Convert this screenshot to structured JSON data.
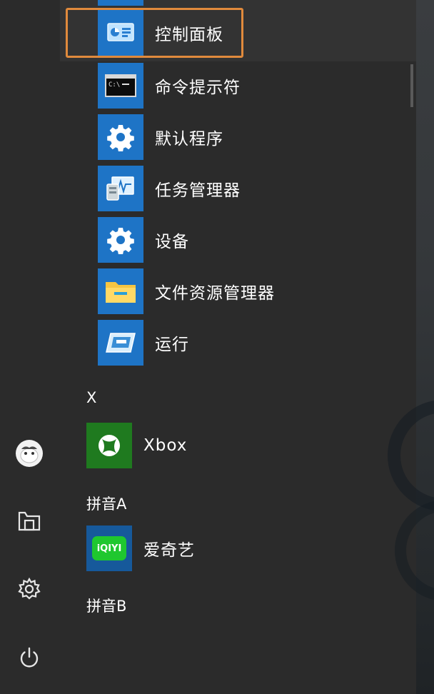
{
  "apps": [
    {
      "label": "控制面板",
      "icon": "control-panel-icon"
    },
    {
      "label": "命令提示符",
      "icon": "command-prompt-icon"
    },
    {
      "label": "默认程序",
      "icon": "gear-icon"
    },
    {
      "label": "任务管理器",
      "icon": "task-manager-icon"
    },
    {
      "label": "设备",
      "icon": "gear-icon"
    },
    {
      "label": "文件资源管理器",
      "icon": "folder-icon"
    },
    {
      "label": "运行",
      "icon": "run-icon"
    }
  ],
  "sections": {
    "x_header": "X",
    "xbox_label": "Xbox",
    "pinyin_a_header": "拼音A",
    "iqiyi_label": "爱奇艺",
    "iqiyi_logo_text": "iQIYI",
    "pinyin_b_header": "拼音B"
  },
  "colors": {
    "menu_background": "#2b2b2b",
    "tile_blue": "#1e74c6",
    "xbox_green": "#1f7a1f",
    "iqiyi_green": "#1fc72f",
    "highlight_orange": "#e08a3c"
  }
}
